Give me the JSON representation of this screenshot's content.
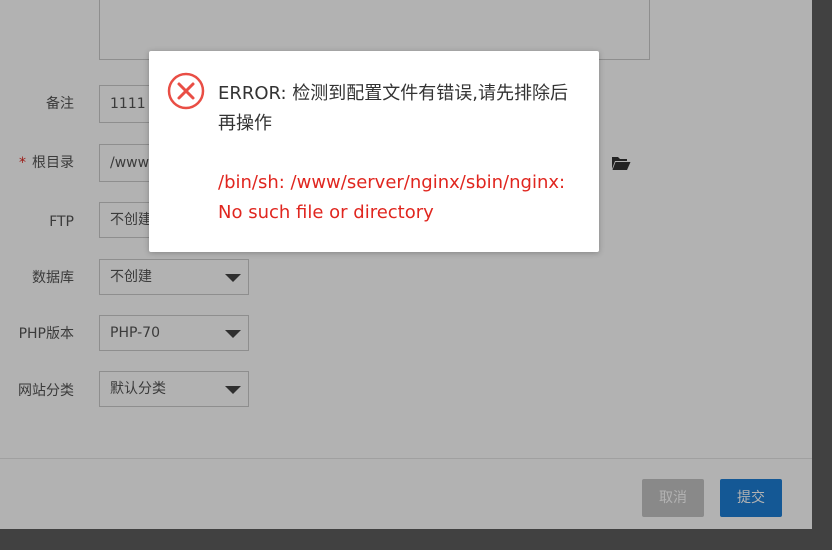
{
  "form": {
    "remark": {
      "label": "备注",
      "value": "1111"
    },
    "root_dir": {
      "required_mark": "*",
      "label": "根目录",
      "value": "/www"
    },
    "ftp": {
      "label": "FTP",
      "value": "不创建"
    },
    "database": {
      "label": "数据库",
      "value": "不创建"
    },
    "php_version": {
      "label": "PHP版本",
      "value": "PHP-70"
    },
    "site_category": {
      "label": "网站分类",
      "value": "默认分类"
    }
  },
  "footer": {
    "cancel_label": "取消",
    "submit_label": "提交"
  },
  "error": {
    "title": "ERROR: 检测到配置文件有错误,请先排除后再操作",
    "detail": "/bin/sh: /www/server/nginx/sbin/nginx: No such file or directory",
    "color": "#e0261f"
  },
  "icons": {
    "folder": "folder-open-icon",
    "error": "error-circle-icon"
  }
}
